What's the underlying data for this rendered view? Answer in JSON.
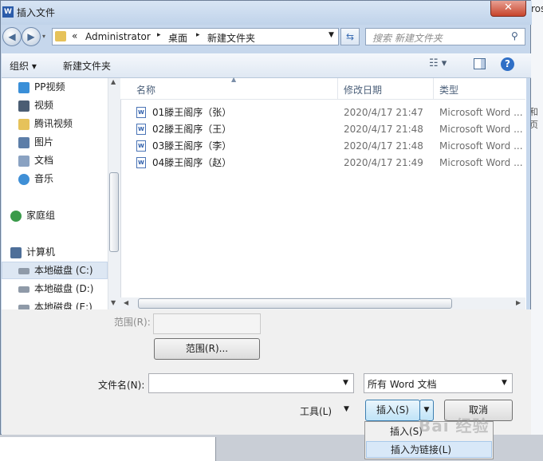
{
  "window": {
    "title": "插入文件",
    "close_glyph": "✕"
  },
  "nav": {
    "back_glyph": "◀",
    "forward_glyph": "▶",
    "address": {
      "prefix": "«",
      "crumbs": [
        "Administrator",
        "桌面",
        "新建文件夹"
      ],
      "sep": "▸"
    },
    "search_placeholder": "搜索 新建文件夹"
  },
  "toolbar": {
    "organize_label": "组织 ▾",
    "new_folder_label": "新建文件夹"
  },
  "sidebar": {
    "items": [
      {
        "label": "PP视频",
        "icon": "folder-video-icon",
        "color": "#3a8fd8"
      },
      {
        "label": "视频",
        "icon": "film-icon",
        "color": "#4b5d73"
      },
      {
        "label": "腾讯视频",
        "icon": "folder-icon",
        "color": "#e6c25a"
      },
      {
        "label": "图片",
        "icon": "picture-icon",
        "color": "#5d7ea8"
      },
      {
        "label": "文档",
        "icon": "document-icon",
        "color": "#8aa2c2"
      },
      {
        "label": "音乐",
        "icon": "music-icon",
        "color": "#3f8fd6"
      },
      {
        "label": "家庭组",
        "icon": "homegroup-icon",
        "color": "#3a9a4a"
      },
      {
        "label": "计算机",
        "icon": "computer-icon",
        "color": "#4e6f99"
      },
      {
        "label": "本地磁盘 (C:)",
        "icon": "drive-c-icon",
        "color": "#8f9aa8"
      },
      {
        "label": "本地磁盘 (D:)",
        "icon": "drive-icon",
        "color": "#8f9aa8"
      },
      {
        "label": "本地磁盘 (E:)",
        "icon": "drive-icon",
        "color": "#8f9aa8"
      }
    ]
  },
  "columns": {
    "name": "名称",
    "modified": "修改日期",
    "type": "类型"
  },
  "files": [
    {
      "name": "01滕王阁序（张）",
      "date": "2020/4/17 21:47",
      "type": "Microsoft Word ..."
    },
    {
      "name": "02滕王阁序（王）",
      "date": "2020/4/17 21:48",
      "type": "Microsoft Word ..."
    },
    {
      "name": "03滕王阁序（李）",
      "date": "2020/4/17 21:48",
      "type": "Microsoft Word ..."
    },
    {
      "name": "04滕王阁序（赵）",
      "date": "2020/4/17 21:49",
      "type": "Microsoft Word ..."
    }
  ],
  "range": {
    "label": "范围(R):",
    "value": "",
    "button_label": "范围(R)..."
  },
  "filename": {
    "label": "文件名(N):",
    "value": ""
  },
  "filetype": {
    "value": "所有 Word 文档"
  },
  "tools_label": "工具(L)",
  "insert_label": "插入(S)",
  "cancel_label": "取消",
  "insert_menu": [
    "插入(S)",
    "插入为链接(L)"
  ],
  "watermark_text": "Bai 经验",
  "background": {
    "right_edge_texts": [
      "ros",
      "和页"
    ]
  }
}
